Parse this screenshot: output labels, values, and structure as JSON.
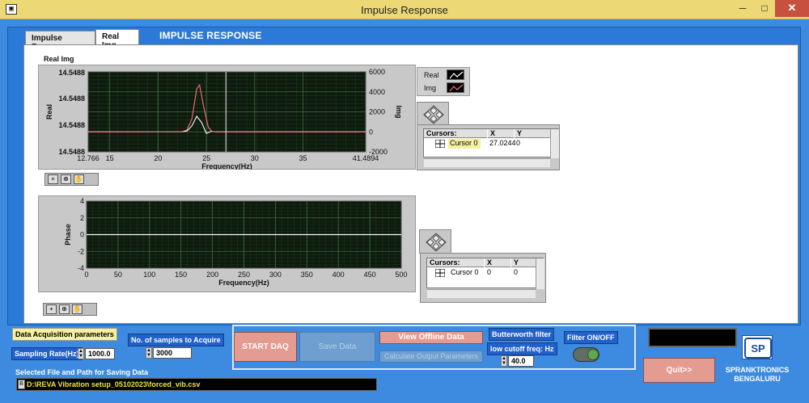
{
  "window": {
    "title": "Impulse Response",
    "app_icon": "labview-icon",
    "min_glyph": "─",
    "max_glyph": "□",
    "close_glyph": "✕"
  },
  "tabs": [
    {
      "label": "Impulse Response",
      "active": false
    },
    {
      "label": "Real Img",
      "active": true
    }
  ],
  "panel_heading": "IMPULSE RESPONSE",
  "graph1": {
    "label": "Real Img",
    "legend": [
      "Real",
      "Img"
    ],
    "cursor_table": {
      "headers": [
        "Cursors:",
        "X",
        "Y"
      ],
      "row": {
        "name": "Cursor 0",
        "x": "27.0244",
        "y": "0"
      }
    }
  },
  "graph2": {
    "cursor_table": {
      "headers": [
        "Cursors:",
        "X",
        "Y"
      ],
      "row": {
        "name": "Cursor 0",
        "x": "0",
        "y": "0"
      }
    }
  },
  "chart_data": [
    {
      "type": "line",
      "xlabel": "Frequency(Hz)",
      "ylabel": "Real",
      "y2label": "Img",
      "xlim": [
        12.766,
        41.4894
      ],
      "x_ticks": [
        "12.766",
        "15",
        "20",
        "25",
        "30",
        "35",
        "41.4894"
      ],
      "y_ticks": [
        "14.5488",
        "14.5488",
        "14.5488",
        "14.5488"
      ],
      "y2_ticks": [
        "6000",
        "4000",
        "2000",
        "0",
        "-2000"
      ],
      "y2lim": [
        -2000,
        6000
      ],
      "cursor_x": 27.0244,
      "grid": true,
      "series": [
        {
          "name": "Real",
          "color": "#ffffff",
          "x": [
            12.766,
            22.5,
            23.0,
            23.5,
            24.0,
            24.5,
            25.0,
            25.5,
            26.0,
            41.4894
          ],
          "y": [
            0,
            10,
            80,
            600,
            1550,
            950,
            -150,
            60,
            0,
            0
          ]
        },
        {
          "name": "Img",
          "color": "#ff6b7a",
          "x": [
            12.766,
            22.5,
            23.0,
            23.5,
            24.0,
            24.3,
            24.7,
            25.2,
            25.6,
            26.0,
            41.4894
          ],
          "y": [
            0,
            30,
            200,
            1300,
            4300,
            4700,
            2600,
            450,
            30,
            0,
            0
          ]
        }
      ]
    },
    {
      "type": "line",
      "xlabel": "Frequency(Hz)",
      "ylabel": "Phase",
      "xlim": [
        0,
        500
      ],
      "ylim": [
        -4,
        4
      ],
      "x_ticks": [
        "0",
        "50",
        "100",
        "150",
        "200",
        "250",
        "300",
        "350",
        "400",
        "450",
        "500"
      ],
      "y_ticks": [
        "4",
        "2",
        "0",
        "-2",
        "-4"
      ],
      "grid": true,
      "series": [
        {
          "name": "Phase",
          "color": "#ffffff",
          "x": [
            0,
            500
          ],
          "y": [
            0,
            0
          ]
        }
      ]
    }
  ],
  "controls": {
    "daq_params_label": "Data Acquisition parameters",
    "sampling_rate_label": "Sampling Rate(Hz)",
    "sampling_rate_value": "1000.0",
    "samples_label": "No. of samples to Acquire",
    "samples_value": "3000",
    "start_daq": "START DAQ",
    "save_data": "Save Data",
    "view_offline": "View Offline Data",
    "calc_params": "Calculate Output  Parameters",
    "butterworth_label": "Butterworth filter",
    "cutoff_label": "low cutoff freq: Hz",
    "cutoff_value": "40.0",
    "filter_label": "Filter ON/OFF",
    "filter_on": true,
    "quit": "Quit>>",
    "path_label": "Selected File and Path for Saving Data",
    "path_value": "D:\\REVA Vibration setup_05102023\\forced_vib.csv",
    "browse_glyph": "B"
  },
  "company": {
    "line1": "SPRANKTRONICS",
    "line2": "BENGALURU",
    "logo_text": "SP"
  }
}
